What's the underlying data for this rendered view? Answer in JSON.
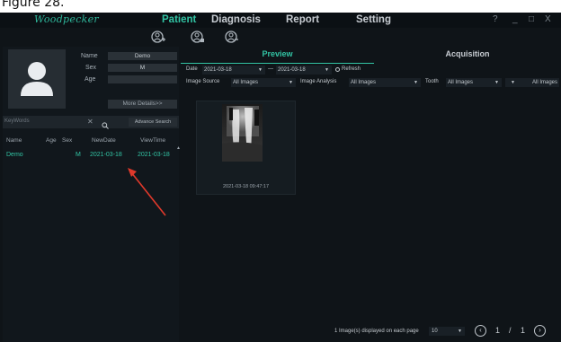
{
  "caption": "Figure 28.",
  "app": {
    "logo": "Woodpecker",
    "nav": [
      {
        "label": "Patient",
        "active": true
      },
      {
        "label": "Diagnosis",
        "active": false
      },
      {
        "label": "Report",
        "active": false
      },
      {
        "label": "Setting",
        "active": false
      }
    ],
    "window_controls": {
      "help": "?",
      "minimize": "_",
      "maximize": "□",
      "close": "X"
    },
    "toolbar_icons": [
      "add-patient-icon",
      "edit-patient-icon",
      "delete-patient-icon"
    ]
  },
  "patient_panel": {
    "fields": [
      {
        "label": "Name",
        "value": "Demo"
      },
      {
        "label": "Sex",
        "value": "M"
      },
      {
        "label": "Age",
        "value": ""
      }
    ],
    "more_details": "More Details>>",
    "search": {
      "placeholder": "KeyWords",
      "advance_label": "Advance Search"
    },
    "columns": [
      "Name",
      "Age",
      "Sex",
      "NewDate",
      "ViewTime"
    ],
    "rows": [
      {
        "name": "Demo",
        "age": "",
        "sex": "M",
        "new_date": "2021-03-18",
        "view_time": "2021-03-18"
      }
    ]
  },
  "right_panel": {
    "tabs": [
      {
        "label": "Preview",
        "active": true
      },
      {
        "label": "Acquisition",
        "active": false
      }
    ],
    "filters": {
      "date_label": "Date",
      "date_from": "2021-03-18",
      "date_sep": "—",
      "date_to": "2021-03-18",
      "refresh": "Refresh",
      "image_source_label": "Image Source",
      "image_source_value": "All Images",
      "image_analysis_label": "Image Analysis",
      "image_analysis_value": "All Images",
      "tooth_label": "Tooth",
      "tooth_value": "All Images",
      "last_value": "All Images"
    },
    "thumbnails": [
      {
        "timestamp": "2021-03-18 09:47:17"
      }
    ],
    "footer": {
      "message": "1 Image(s) displayed on each page",
      "per_page": "10",
      "page_current": "1",
      "page_sep": "/",
      "page_total": "1"
    }
  },
  "colors": {
    "accent": "#32c4a4",
    "background": "#0f1418",
    "arrow": "#e0392b"
  }
}
